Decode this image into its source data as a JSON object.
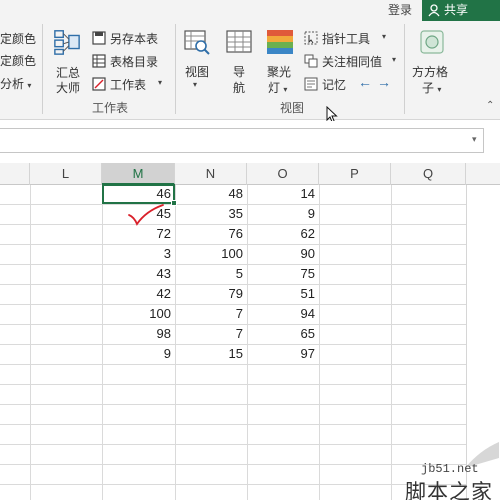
{
  "topbar": {
    "login": "登录",
    "share": "共享"
  },
  "ribbon": {
    "left_items": [
      "定颜色",
      "定颜色",
      "分析"
    ],
    "huizong_line1": "汇总",
    "huizong_line2": "大师",
    "workbook_items": [
      "另存本表",
      "表格目录",
      "工作表"
    ],
    "group_workbook": "工作表",
    "view_label": "视图",
    "nav_line1": "导",
    "nav_line2": "航",
    "spotlight_line1": "聚光",
    "spotlight_line2": "灯",
    "view_items": [
      "指针工具",
      "关注相同值",
      "记忆"
    ],
    "group_view": "视图",
    "grid_line1": "方方格",
    "grid_line2": "子"
  },
  "sheet": {
    "columns": [
      "L",
      "M",
      "N",
      "O",
      "P",
      "Q"
    ],
    "active_column": "M",
    "rows": [
      [
        "46",
        "48",
        "14"
      ],
      [
        "45",
        "35",
        "9"
      ],
      [
        "72",
        "76",
        "62"
      ],
      [
        "3",
        "100",
        "90"
      ],
      [
        "43",
        "5",
        "75"
      ],
      [
        "42",
        "79",
        "51"
      ],
      [
        "100",
        "7",
        "94"
      ],
      [
        "98",
        "7",
        "65"
      ],
      [
        "9",
        "15",
        "97"
      ]
    ]
  },
  "watermark": {
    "url": "jb51.net",
    "name": "脚本之家"
  },
  "colors": {
    "accent": "#217346",
    "annotation": "#d9202a"
  }
}
